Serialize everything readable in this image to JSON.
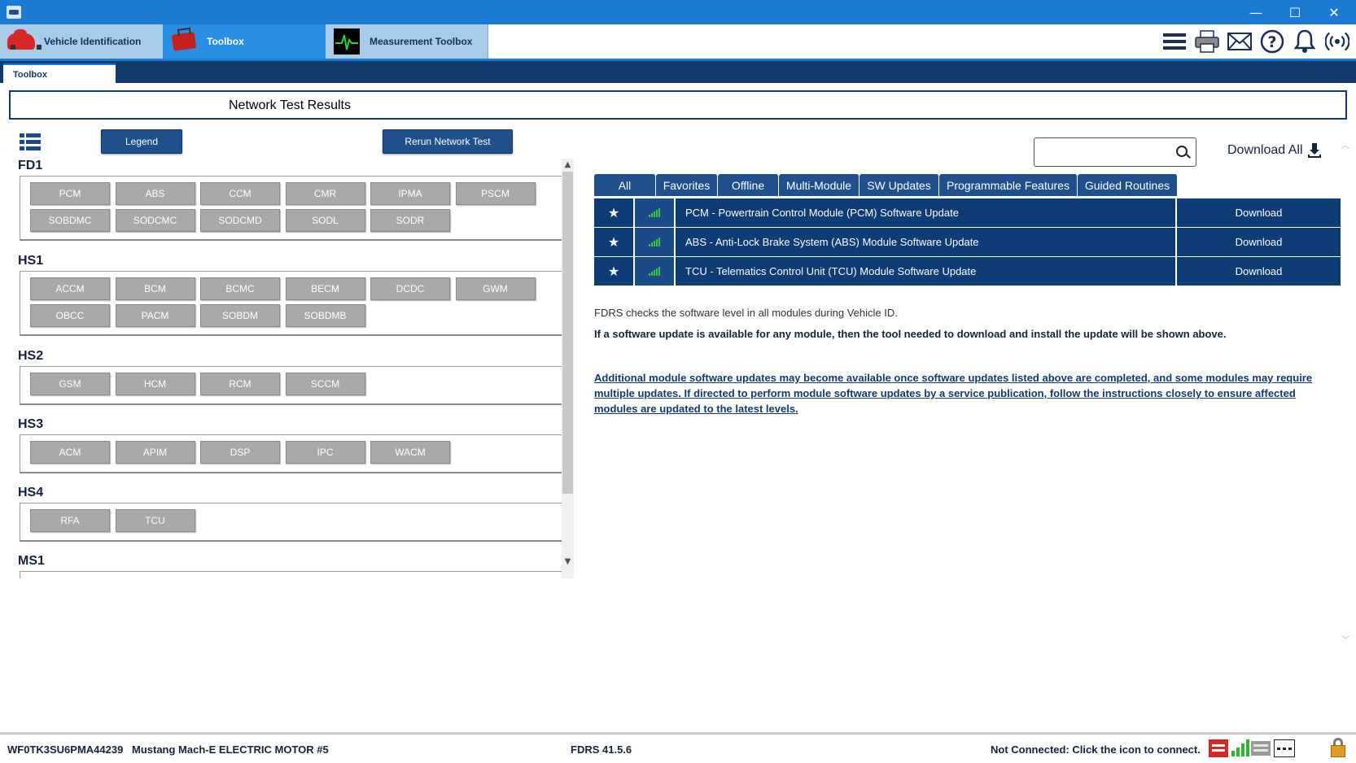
{
  "titlebar": {
    "minimize": "—",
    "maximize": "☐",
    "close": "✕"
  },
  "nav": {
    "tabs": [
      {
        "label": "Vehicle Identification",
        "icon": "car-icon"
      },
      {
        "label": "Toolbox",
        "icon": "toolbox-icon",
        "active": true
      },
      {
        "label": "Measurement Toolbox",
        "icon": "oscilloscope-icon"
      }
    ],
    "right_icons": [
      "menu-icon",
      "printer-icon",
      "mail-icon",
      "help-icon",
      "bell-icon",
      "wireless-icon"
    ]
  },
  "subtab": {
    "label": "Toolbox"
  },
  "page_title": "Network Test Results",
  "buttons": {
    "legend": "Legend",
    "rerun": "Rerun Network Test"
  },
  "network_groups": [
    {
      "name": "FD1",
      "modules": [
        "PCM",
        "ABS",
        "CCM",
        "CMR",
        "IPMA",
        "PSCM",
        "SOBDMC",
        "SODCMC",
        "SODCMD",
        "SODL",
        "SODR"
      ]
    },
    {
      "name": "HS1",
      "modules": [
        "ACCM",
        "BCM",
        "BCMC",
        "BECM",
        "DCDC",
        "GWM",
        "OBCC",
        "PACM",
        "SOBDM",
        "SOBDMB"
      ]
    },
    {
      "name": "HS2",
      "modules": [
        "GSM",
        "HCM",
        "RCM",
        "SCCM"
      ]
    },
    {
      "name": "HS3",
      "modules": [
        "ACM",
        "APIM",
        "DSP",
        "IPC",
        "WACM"
      ]
    },
    {
      "name": "HS4",
      "modules": [
        "RFA",
        "TCU"
      ]
    },
    {
      "name": "MS1",
      "modules": []
    }
  ],
  "search": {
    "value": "",
    "placeholder": ""
  },
  "download_all": "Download All",
  "filter_tabs": [
    "All",
    "Favorites",
    "Offline",
    "Multi-Module",
    "SW Updates",
    "Programmable Features",
    "Guided Routines"
  ],
  "updates": [
    {
      "name": "PCM - Powertrain Control Module (PCM) Software Update",
      "action": "Download"
    },
    {
      "name": "ABS - Anti-Lock Brake System (ABS) Module Software Update",
      "action": "Download"
    },
    {
      "name": "TCU - Telematics Control Unit (TCU) Module Software Update",
      "action": "Download"
    }
  ],
  "info": {
    "line1": "FDRS checks the software level in all modules during Vehicle ID.",
    "line2": "If a software update is available for any module, then the tool needed to download and install the update will be shown above.",
    "line3": "Additional module software updates may become available once software updates listed above are completed, and some modules may require multiple updates. If directed to perform module software updates by a service publication, follow the instructions closely to ensure affected modules are updated to the latest levels."
  },
  "status": {
    "vin": "WF0TK3SU6PMA44239",
    "vehicle": "Mustang Mach-E ELECTRIC MOTOR #5",
    "version": "FDRS 41.5.6",
    "connection": "Not Connected: Click the icon to connect.",
    "icons": [
      "vci-red-icon",
      "signal-green-icon",
      "vci-gray-icon",
      "dash-icon",
      "lock-icon"
    ]
  },
  "colors": {
    "titlebar": "#1a7ad4",
    "dark_navy": "#0f3b76",
    "module_button": "#a9a9a9",
    "signal_green": "#39c43c"
  }
}
